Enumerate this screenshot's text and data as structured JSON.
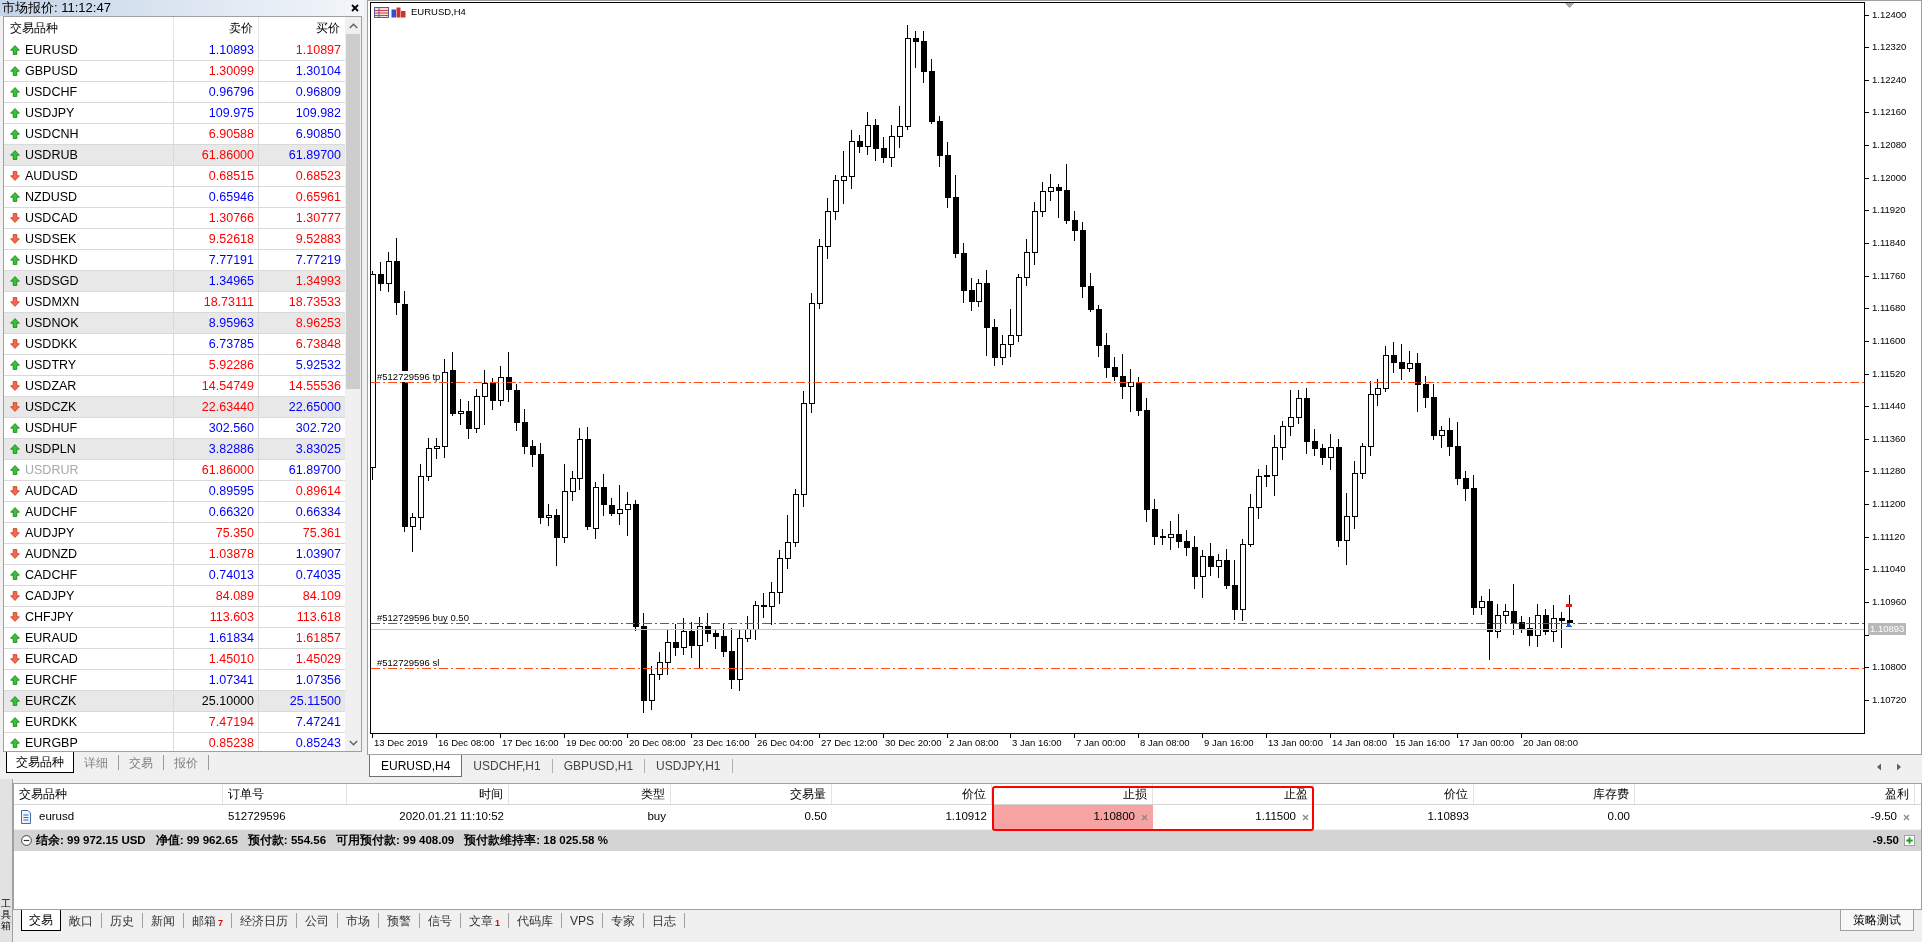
{
  "market_watch": {
    "title": "市场报价: 11:12:47",
    "columns": [
      "交易品种",
      "卖价",
      "买价"
    ],
    "rows": [
      {
        "symbol": "EURUSD",
        "rising": true,
        "shaded": false,
        "disabled": false,
        "bid": {
          "value": "1.10893",
          "color": "#0000ff"
        },
        "ask": {
          "value": "1.10897",
          "color": "#ff0000"
        }
      },
      {
        "symbol": "GBPUSD",
        "rising": true,
        "shaded": false,
        "disabled": false,
        "bid": {
          "value": "1.30099",
          "color": "#ff0000"
        },
        "ask": {
          "value": "1.30104",
          "color": "#0000ff"
        }
      },
      {
        "symbol": "USDCHF",
        "rising": true,
        "shaded": false,
        "disabled": false,
        "bid": {
          "value": "0.96796",
          "color": "#0000ff"
        },
        "ask": {
          "value": "0.96809",
          "color": "#0000ff"
        }
      },
      {
        "symbol": "USDJPY",
        "rising": true,
        "shaded": false,
        "disabled": false,
        "bid": {
          "value": "109.975",
          "color": "#0000ff"
        },
        "ask": {
          "value": "109.982",
          "color": "#0000ff"
        }
      },
      {
        "symbol": "USDCNH",
        "rising": true,
        "shaded": false,
        "disabled": false,
        "bid": {
          "value": "6.90588",
          "color": "#ff0000"
        },
        "ask": {
          "value": "6.90850",
          "color": "#0000ff"
        }
      },
      {
        "symbol": "USDRUB",
        "rising": true,
        "shaded": true,
        "disabled": false,
        "bid": {
          "value": "61.86000",
          "color": "#ff0000"
        },
        "ask": {
          "value": "61.89700",
          "color": "#0000ff"
        }
      },
      {
        "symbol": "AUDUSD",
        "rising": false,
        "shaded": false,
        "disabled": false,
        "bid": {
          "value": "0.68515",
          "color": "#ff0000"
        },
        "ask": {
          "value": "0.68523",
          "color": "#ff0000"
        }
      },
      {
        "symbol": "NZDUSD",
        "rising": true,
        "shaded": false,
        "disabled": false,
        "bid": {
          "value": "0.65946",
          "color": "#0000ff"
        },
        "ask": {
          "value": "0.65961",
          "color": "#ff0000"
        }
      },
      {
        "symbol": "USDCAD",
        "rising": false,
        "shaded": false,
        "disabled": false,
        "bid": {
          "value": "1.30766",
          "color": "#ff0000"
        },
        "ask": {
          "value": "1.30777",
          "color": "#ff0000"
        }
      },
      {
        "symbol": "USDSEK",
        "rising": false,
        "shaded": false,
        "disabled": false,
        "bid": {
          "value": "9.52618",
          "color": "#ff0000"
        },
        "ask": {
          "value": "9.52883",
          "color": "#ff0000"
        }
      },
      {
        "symbol": "USDHKD",
        "rising": true,
        "shaded": false,
        "disabled": false,
        "bid": {
          "value": "7.77191",
          "color": "#0000ff"
        },
        "ask": {
          "value": "7.77219",
          "color": "#0000ff"
        }
      },
      {
        "symbol": "USDSGD",
        "rising": true,
        "shaded": true,
        "disabled": false,
        "bid": {
          "value": "1.34965",
          "color": "#0000ff"
        },
        "ask": {
          "value": "1.34993",
          "color": "#ff0000"
        }
      },
      {
        "symbol": "USDMXN",
        "rising": false,
        "shaded": false,
        "disabled": false,
        "bid": {
          "value": "18.73111",
          "color": "#ff0000"
        },
        "ask": {
          "value": "18.73533",
          "color": "#ff0000"
        }
      },
      {
        "symbol": "USDNOK",
        "rising": true,
        "shaded": true,
        "disabled": false,
        "bid": {
          "value": "8.95963",
          "color": "#0000ff"
        },
        "ask": {
          "value": "8.96253",
          "color": "#ff0000"
        }
      },
      {
        "symbol": "USDDKK",
        "rising": false,
        "shaded": false,
        "disabled": false,
        "bid": {
          "value": "6.73785",
          "color": "#0000ff"
        },
        "ask": {
          "value": "6.73848",
          "color": "#ff0000"
        }
      },
      {
        "symbol": "USDTRY",
        "rising": true,
        "shaded": false,
        "disabled": false,
        "bid": {
          "value": "5.92286",
          "color": "#ff0000"
        },
        "ask": {
          "value": "5.92532",
          "color": "#0000ff"
        }
      },
      {
        "symbol": "USDZAR",
        "rising": false,
        "shaded": false,
        "disabled": false,
        "bid": {
          "value": "14.54749",
          "color": "#ff0000"
        },
        "ask": {
          "value": "14.55536",
          "color": "#ff0000"
        }
      },
      {
        "symbol": "USDCZK",
        "rising": false,
        "shaded": true,
        "disabled": false,
        "bid": {
          "value": "22.63440",
          "color": "#ff0000"
        },
        "ask": {
          "value": "22.65000",
          "color": "#0000ff"
        }
      },
      {
        "symbol": "USDHUF",
        "rising": true,
        "shaded": false,
        "disabled": false,
        "bid": {
          "value": "302.560",
          "color": "#0000ff"
        },
        "ask": {
          "value": "302.720",
          "color": "#0000ff"
        }
      },
      {
        "symbol": "USDPLN",
        "rising": true,
        "shaded": true,
        "disabled": false,
        "bid": {
          "value": "3.82886",
          "color": "#0000ff"
        },
        "ask": {
          "value": "3.83025",
          "color": "#0000ff"
        }
      },
      {
        "symbol": "USDRUR",
        "rising": true,
        "shaded": false,
        "disabled": true,
        "bid": {
          "value": "61.86000",
          "color": "#ff0000"
        },
        "ask": {
          "value": "61.89700",
          "color": "#0000ff"
        }
      },
      {
        "symbol": "AUDCAD",
        "rising": false,
        "shaded": false,
        "disabled": false,
        "bid": {
          "value": "0.89595",
          "color": "#0000ff"
        },
        "ask": {
          "value": "0.89614",
          "color": "#ff0000"
        }
      },
      {
        "symbol": "AUDCHF",
        "rising": true,
        "shaded": false,
        "disabled": false,
        "bid": {
          "value": "0.66320",
          "color": "#0000ff"
        },
        "ask": {
          "value": "0.66334",
          "color": "#0000ff"
        }
      },
      {
        "symbol": "AUDJPY",
        "rising": false,
        "shaded": false,
        "disabled": false,
        "bid": {
          "value": "75.350",
          "color": "#ff0000"
        },
        "ask": {
          "value": "75.361",
          "color": "#ff0000"
        }
      },
      {
        "symbol": "AUDNZD",
        "rising": false,
        "shaded": false,
        "disabled": false,
        "bid": {
          "value": "1.03878",
          "color": "#ff0000"
        },
        "ask": {
          "value": "1.03907",
          "color": "#0000ff"
        }
      },
      {
        "symbol": "CADCHF",
        "rising": true,
        "shaded": false,
        "disabled": false,
        "bid": {
          "value": "0.74013",
          "color": "#0000ff"
        },
        "ask": {
          "value": "0.74035",
          "color": "#0000ff"
        }
      },
      {
        "symbol": "CADJPY",
        "rising": false,
        "shaded": false,
        "disabled": false,
        "bid": {
          "value": "84.089",
          "color": "#ff0000"
        },
        "ask": {
          "value": "84.109",
          "color": "#ff0000"
        }
      },
      {
        "symbol": "CHFJPY",
        "rising": false,
        "shaded": false,
        "disabled": false,
        "bid": {
          "value": "113.603",
          "color": "#ff0000"
        },
        "ask": {
          "value": "113.618",
          "color": "#ff0000"
        }
      },
      {
        "symbol": "EURAUD",
        "rising": true,
        "shaded": false,
        "disabled": false,
        "bid": {
          "value": "1.61834",
          "color": "#0000ff"
        },
        "ask": {
          "value": "1.61857",
          "color": "#ff0000"
        }
      },
      {
        "symbol": "EURCAD",
        "rising": false,
        "shaded": false,
        "disabled": false,
        "bid": {
          "value": "1.45010",
          "color": "#ff0000"
        },
        "ask": {
          "value": "1.45029",
          "color": "#ff0000"
        }
      },
      {
        "symbol": "EURCHF",
        "rising": true,
        "shaded": false,
        "disabled": false,
        "bid": {
          "value": "1.07341",
          "color": "#0000ff"
        },
        "ask": {
          "value": "1.07356",
          "color": "#0000ff"
        }
      },
      {
        "symbol": "EURCZK",
        "rising": true,
        "shaded": true,
        "disabled": false,
        "bid": {
          "value": "25.10000",
          "color": "#000000"
        },
        "ask": {
          "value": "25.11500",
          "color": "#0000ff"
        }
      },
      {
        "symbol": "EURDKK",
        "rising": true,
        "shaded": false,
        "disabled": false,
        "bid": {
          "value": "7.47194",
          "color": "#ff0000"
        },
        "ask": {
          "value": "7.47241",
          "color": "#0000ff"
        }
      },
      {
        "symbol": "EURGBP",
        "rising": true,
        "shaded": false,
        "disabled": false,
        "bid": {
          "value": "0.85238",
          "color": "#ff0000"
        },
        "ask": {
          "value": "0.85243",
          "color": "#0000ff"
        }
      }
    ],
    "tabs": [
      {
        "label": "交易品种",
        "selected": true
      },
      {
        "label": "详细",
        "selected": false
      },
      {
        "label": "交易",
        "selected": false
      },
      {
        "label": "报价",
        "selected": false
      }
    ]
  },
  "chart": {
    "symbol_label": "EURUSD,H4",
    "price_axis": [
      "1.12400",
      "1.12320",
      "1.12240",
      "1.12160",
      "1.12080",
      "1.12000",
      "1.11920",
      "1.11840",
      "1.11760",
      "1.11680",
      "1.11600",
      "1.11520",
      "1.11440",
      "1.11360",
      "1.11280",
      "1.11200",
      "1.11120",
      "1.11040",
      "1.10960",
      "1.10800",
      "1.10720"
    ],
    "current_price": "1.10893",
    "time_axis": [
      "13 Dec 2019",
      "16 Dec 08:00",
      "17 Dec 16:00",
      "19 Dec 00:00",
      "20 Dec 08:00",
      "23 Dec 16:00",
      "26 Dec 04:00",
      "27 Dec 12:00",
      "30 Dec 20:00",
      "2 Jan 08:00",
      "3 Jan 16:00",
      "7 Jan 00:00",
      "8 Jan 08:00",
      "9 Jan 16:00",
      "13 Jan 00:00",
      "14 Jan 08:00",
      "15 Jan 16:00",
      "17 Jan 00:00",
      "20 Jan 08:00"
    ],
    "order_lines": [
      {
        "kind": "tp",
        "label": "#512729596 tp"
      },
      {
        "kind": "entry",
        "label": "#512729596 buy 0.50"
      },
      {
        "kind": "sl",
        "label": "#512729596 sl"
      }
    ],
    "tabs": [
      {
        "label": "EURUSD,H4",
        "selected": true
      },
      {
        "label": "USDCHF,H1",
        "selected": false
      },
      {
        "label": "GBPUSD,H1",
        "selected": false
      },
      {
        "label": "USDJPY,H1",
        "selected": false
      }
    ]
  },
  "toolbox": {
    "side_title": "工具箱",
    "columns": [
      "交易品种",
      "订单号",
      "时间",
      "类型",
      "交易量",
      "价位",
      "止损",
      "止盈",
      "价位",
      "库存费",
      "盈利"
    ],
    "trades": [
      {
        "symbol": "eurusd",
        "order": "512729596",
        "time": "2020.01.21 11:10:52",
        "type": "buy",
        "volume": "0.50",
        "open_price": "1.10912",
        "sl": "1.10800",
        "sl_highlighted": true,
        "tp": "1.11500",
        "price": "1.10893",
        "swap": "0.00",
        "profit": "-9.50"
      }
    ],
    "summary": {
      "items": [
        "结余: 99 972.15 USD",
        "净值: 99 962.65",
        "预付款: 554.56",
        "可用预付款: 99 408.09",
        "预付款维持率: 18 025.58 %"
      ],
      "profit": "-9.50"
    },
    "tabs": [
      {
        "label": "交易",
        "selected": true
      },
      {
        "label": "敞口",
        "selected": false
      },
      {
        "label": "历史",
        "selected": false
      },
      {
        "label": "新闻",
        "selected": false
      },
      {
        "label": "邮箱",
        "badge": "7",
        "selected": false
      },
      {
        "label": "经济日历",
        "selected": false
      },
      {
        "label": "公司",
        "selected": false
      },
      {
        "label": "市场",
        "selected": false
      },
      {
        "label": "预警",
        "selected": false
      },
      {
        "label": "信号",
        "selected": false
      },
      {
        "label": "文章",
        "badge": "1",
        "selected": false
      },
      {
        "label": "代码库",
        "selected": false
      },
      {
        "label": "VPS",
        "selected": false
      },
      {
        "label": "专家",
        "selected": false
      },
      {
        "label": "日志",
        "selected": false
      }
    ],
    "tester_tab": "策略测试"
  }
}
